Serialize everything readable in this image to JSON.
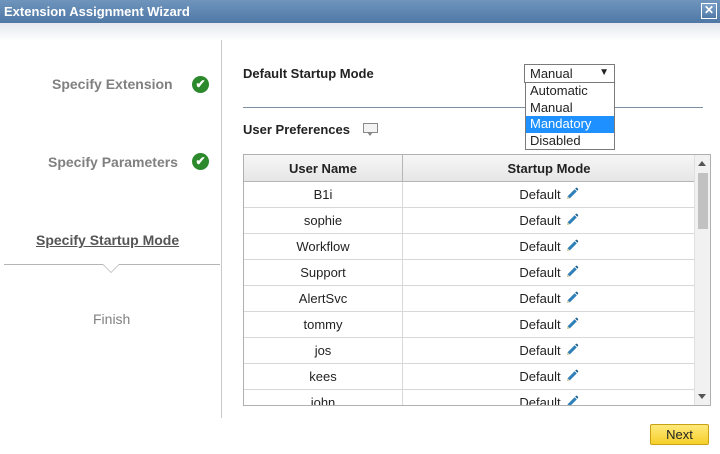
{
  "window": {
    "title": "Extension Assignment Wizard",
    "close_glyph": "✕"
  },
  "steps": [
    {
      "label": "Specify Extension",
      "done": true
    },
    {
      "label": "Specify Parameters",
      "done": true
    },
    {
      "label": "Specify Startup Mode",
      "done": false,
      "current": true
    },
    {
      "label": "Finish",
      "done": false
    }
  ],
  "check_glyph": "✔",
  "startup": {
    "label": "Default Startup Mode",
    "value": "Manual",
    "caret": "▼",
    "options": [
      "Automatic",
      "Manual",
      "Mandatory",
      "Disabled"
    ],
    "highlighted": "Mandatory"
  },
  "preferences": {
    "label": "User Preferences",
    "columns": [
      "User Name",
      "Startup Mode"
    ],
    "rows": [
      {
        "user": "B1i",
        "mode": "Default"
      },
      {
        "user": "sophie",
        "mode": "Default"
      },
      {
        "user": "Workflow",
        "mode": "Default"
      },
      {
        "user": "Support",
        "mode": "Default"
      },
      {
        "user": "AlertSvc",
        "mode": "Default"
      },
      {
        "user": "tommy",
        "mode": "Default"
      },
      {
        "user": "jos",
        "mode": "Default"
      },
      {
        "user": "kees",
        "mode": "Default"
      },
      {
        "user": "john",
        "mode": "Default"
      }
    ]
  },
  "footer": {
    "next_label": "Next"
  },
  "colors": {
    "titlebar": "#4f78a6",
    "check": "#2c8a2c",
    "selected_option": "#1e90ff",
    "next_button": "#f6cf2a",
    "pencil": "#2f7fb8"
  },
  "icons": {
    "edit": "pencil-icon",
    "comment": "comment-icon",
    "close": "close-icon"
  }
}
